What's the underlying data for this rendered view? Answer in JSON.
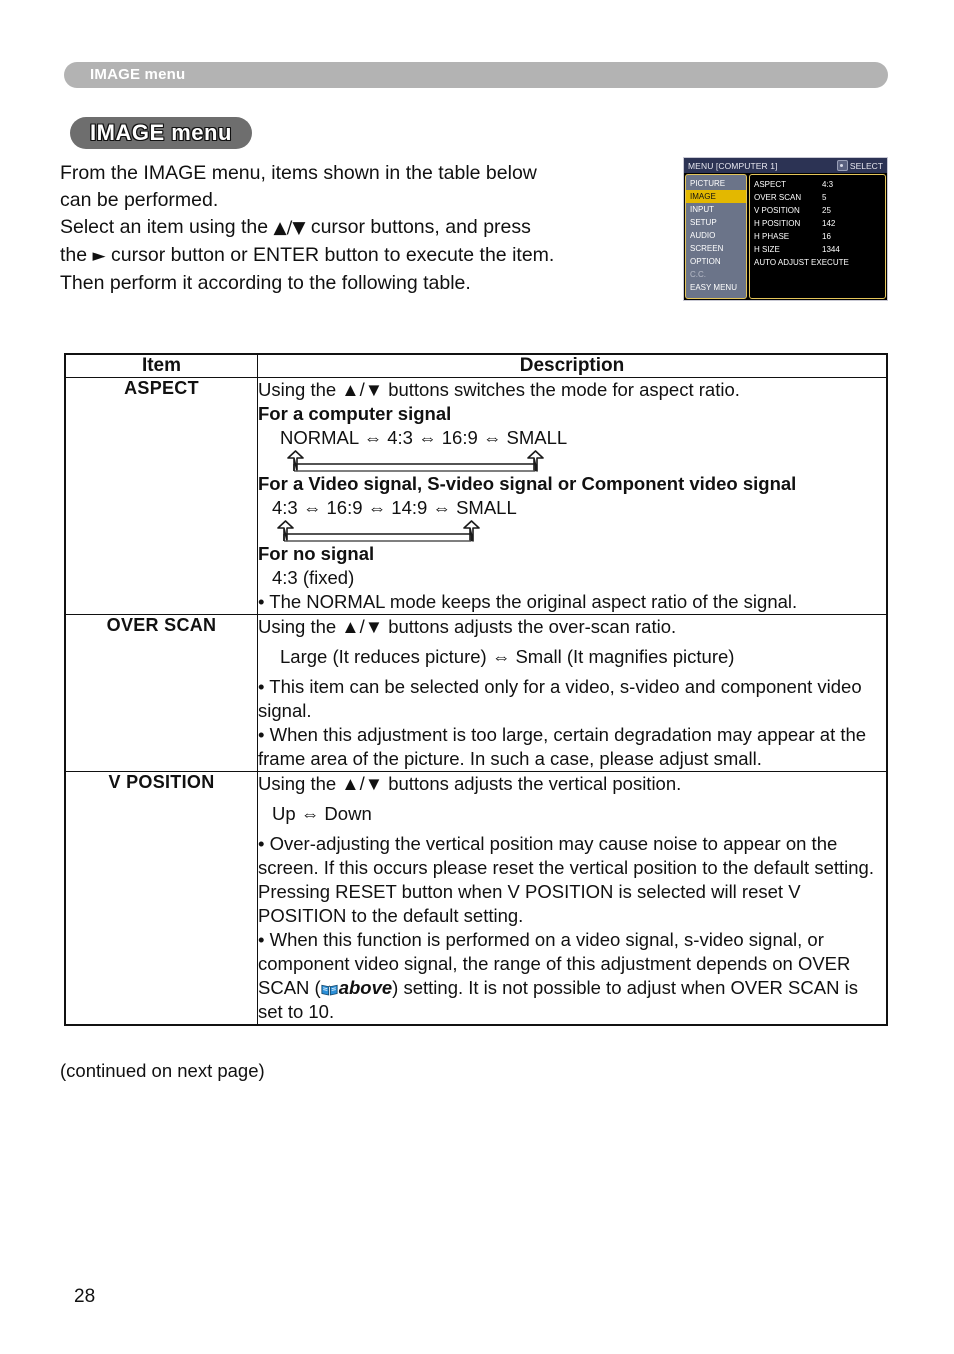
{
  "running_header": {
    "label": "IMAGE menu"
  },
  "section": {
    "title": "IMAGE menu"
  },
  "intro": {
    "line1": "From the IMAGE menu, items shown in the table below",
    "line2": "can be performed.",
    "line3_a": "Select an item using the ",
    "line3_updown": "▲/▼",
    "line3_b": " cursor buttons, and press",
    "line4_a": "the ",
    "line4_right": "►",
    "line4_b": " cursor button or ENTER button to execute the item.",
    "line5": "Then perform it according to the following table."
  },
  "osd": {
    "title": "MENU [COMPUTER 1]",
    "select_label": "SELECT",
    "select_icon": "select-button-icon",
    "sidebar": [
      {
        "label": "PICTURE",
        "selected": false,
        "dim": false
      },
      {
        "label": "IMAGE",
        "selected": true,
        "dim": false
      },
      {
        "label": "INPUT",
        "selected": false,
        "dim": false
      },
      {
        "label": "SETUP",
        "selected": false,
        "dim": false
      },
      {
        "label": "AUDIO",
        "selected": false,
        "dim": false
      },
      {
        "label": "SCREEN",
        "selected": false,
        "dim": false
      },
      {
        "label": "OPTION",
        "selected": false,
        "dim": false
      },
      {
        "label": "C.C.",
        "selected": false,
        "dim": true
      },
      {
        "label": "EASY MENU",
        "selected": false,
        "dim": false
      }
    ],
    "items": [
      {
        "name": "ASPECT",
        "value": "4:3"
      },
      {
        "name": "OVER SCAN",
        "value": "5"
      },
      {
        "name": "V POSITION",
        "value": "25"
      },
      {
        "name": "H POSITION",
        "value": "142"
      },
      {
        "name": "H PHASE",
        "value": "16"
      },
      {
        "name": "H SIZE",
        "value": "1344"
      },
      {
        "name": "AUTO ADJUST EXECUTE",
        "value": ""
      }
    ],
    "colors": {
      "titlebar": "#2c3354",
      "sidebar": "#6b7489",
      "highlight": "#e3b800",
      "frame": "#e4c55a",
      "background": "#000000"
    }
  },
  "table": {
    "headers": {
      "item": "Item",
      "description": "Description"
    },
    "rows": [
      {
        "item": "ASPECT",
        "intro": "Using the ▲/▼ buttons switches the mode for aspect ratio.",
        "heading1": "For a computer signal",
        "chain1": "NORMAL ⇔ 4:3 ⇔ 16:9 ⇔ SMALL",
        "heading2": "For a Video signal, S-video signal or Component video signal",
        "chain2": "4:3 ⇔ 16:9 ⇔ 14:9 ⇔ SMALL",
        "heading3": "For no signal",
        "chain3": "4:3 (fixed)",
        "bullet1": "• The NORMAL mode keeps the original aspect ratio of the signal."
      },
      {
        "item": "OVER SCAN",
        "intro": "Using the ▲/▼ buttons adjusts the over-scan ratio.",
        "chain1": "Large (It reduces picture) ⇔ Small (It magnifies picture)",
        "bullet1": "• This item can be selected only for a video, s-video and component video signal.",
        "bullet2": "• When this adjustment is too large, certain degradation may appear at the frame area of the picture. In such a case, please adjust small."
      },
      {
        "item": "V POSITION",
        "intro": "Using the ▲/▼ buttons adjusts the vertical position.",
        "chain1": "Up ⇔ Down",
        "bullet1": "• Over-adjusting the vertical position may cause noise to appear on the screen. If this occurs please reset the vertical position to the default setting.",
        "para2": "Pressing RESET button when V POSITION is selected will reset V POSITION to the default setting.",
        "bullet2_a": "• When this function is performed on a video signal, s-video signal, or component video signal, the range of this adjustment depends on OVER SCAN (",
        "bullet2_ref": "above",
        "bullet2_b": ") setting. It is not possible to adjust when OVER SCAN is set to 10."
      }
    ]
  },
  "footnote": "(continued on next page)",
  "page_number": "28"
}
